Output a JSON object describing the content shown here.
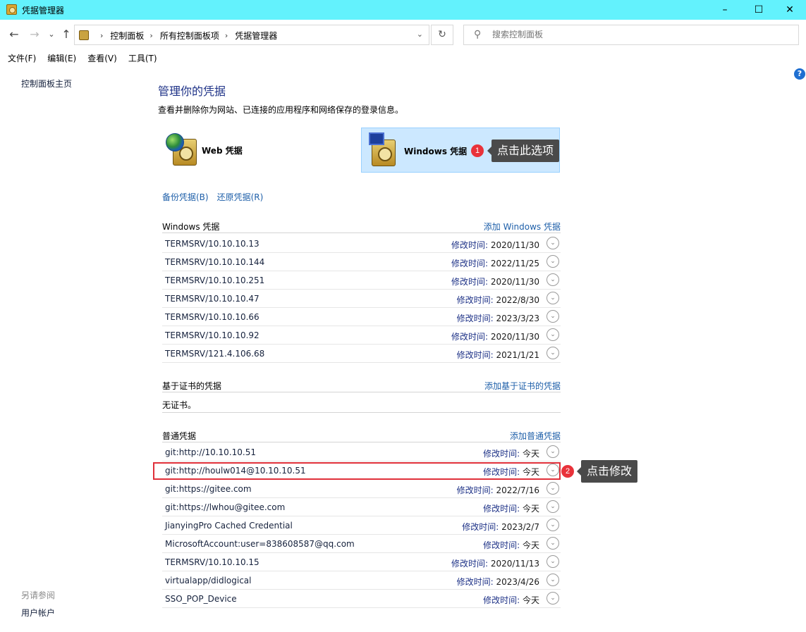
{
  "window": {
    "title": "凭据管理器",
    "minimize": "–",
    "maximize": "☐",
    "close": "✕"
  },
  "nav": {
    "back": "←",
    "forward": "→",
    "recent": "⌄",
    "up": "↑",
    "breadcrumbs": [
      "控制面板",
      "所有控制面板项",
      "凭据管理器"
    ],
    "refresh": "↻",
    "search_placeholder": "搜索控制面板"
  },
  "menu": [
    "文件(F)",
    "编辑(E)",
    "查看(V)",
    "工具(T)"
  ],
  "left_pane": {
    "home": "控制面板主页",
    "see_also": "另请参阅",
    "user_accounts": "用户帐户"
  },
  "main": {
    "title": "管理你的凭据",
    "description": "查看并删除你为网站、已连接的应用程序和网络保存的登录信息。",
    "web_tile": "Web 凭据",
    "windows_tile": "Windows 凭据",
    "backup": "备份凭据(B)",
    "restore": "还原凭据(R)"
  },
  "annotations": {
    "badge1": "1",
    "tip1": "点击此选项",
    "badge2": "2",
    "tip2": "点击修改"
  },
  "modified_label": "修改时间:",
  "windows_section": {
    "title": "Windows 凭据",
    "add": "添加 Windows 凭据",
    "items": [
      {
        "name": "TERMSRV/10.10.10.13",
        "date": "2020/11/30"
      },
      {
        "name": "TERMSRV/10.10.10.144",
        "date": "2022/11/25"
      },
      {
        "name": "TERMSRV/10.10.10.251",
        "date": "2020/11/30"
      },
      {
        "name": "TERMSRV/10.10.10.47",
        "date": "2022/8/30"
      },
      {
        "name": "TERMSRV/10.10.10.66",
        "date": "2023/3/23"
      },
      {
        "name": "TERMSRV/10.10.10.92",
        "date": "2020/11/30"
      },
      {
        "name": "TERMSRV/121.4.106.68",
        "date": "2021/1/21"
      }
    ]
  },
  "cert_section": {
    "title": "基于证书的凭据",
    "add": "添加基于证书的凭据",
    "empty": "无证书。"
  },
  "generic_section": {
    "title": "普通凭据",
    "add": "添加普通凭据",
    "items": [
      {
        "name": "git:http://10.10.10.51",
        "date": "今天"
      },
      {
        "name": "git:http://houlw014@10.10.10.51",
        "date": "今天"
      },
      {
        "name": "git:https://gitee.com",
        "date": "2022/7/16"
      },
      {
        "name": "git:https://lwhou@gitee.com",
        "date": "今天"
      },
      {
        "name": "JianyingPro Cached Credential",
        "date": "2023/2/7"
      },
      {
        "name": "MicrosoftAccount:user=838608587@qq.com",
        "date": "今天"
      },
      {
        "name": "TERMSRV/10.10.10.15",
        "date": "2020/11/13"
      },
      {
        "name": "virtualapp/didlogical",
        "date": "2023/4/26"
      },
      {
        "name": "SSO_POP_Device",
        "date": "今天"
      }
    ]
  },
  "colors": {
    "titlebar": "#63f2fd",
    "heading": "#1e3287",
    "link": "#1e5fa9",
    "selected_tile": "#cce8ff",
    "annotation_red": "#e9323a",
    "tooltip_bg": "#4a4a4a"
  }
}
